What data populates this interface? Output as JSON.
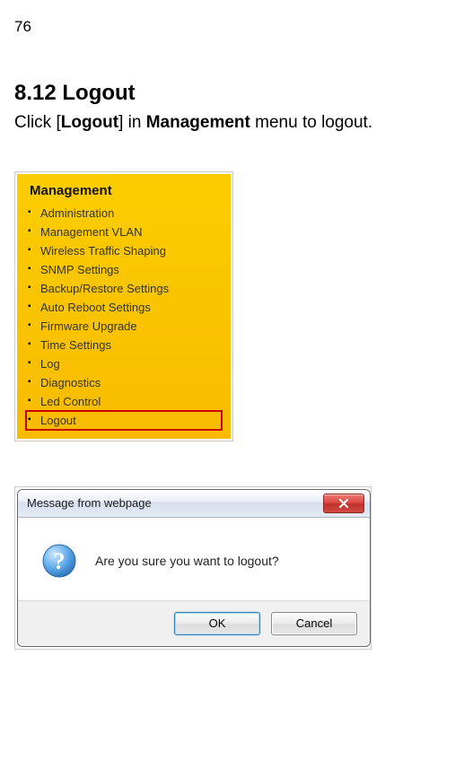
{
  "page": {
    "number": "76"
  },
  "section": {
    "title": "8.12 Logout"
  },
  "instruction": {
    "pre": "Click [",
    "bold1": "Logout",
    "mid": "] in ",
    "bold2": "Management",
    "post": " menu to logout."
  },
  "mgmt": {
    "title": "Management",
    "items": [
      {
        "label": "Administration"
      },
      {
        "label": "Management VLAN"
      },
      {
        "label": "Wireless Traffic Shaping"
      },
      {
        "label": "SNMP Settings"
      },
      {
        "label": "Backup/Restore Settings"
      },
      {
        "label": "Auto Reboot Settings"
      },
      {
        "label": "Firmware Upgrade"
      },
      {
        "label": "Time Settings"
      },
      {
        "label": "Log"
      },
      {
        "label": "Diagnostics"
      },
      {
        "label": "Led Control"
      },
      {
        "label": "Logout"
      }
    ]
  },
  "dialog": {
    "title": "Message from webpage",
    "message": "Are you sure you want to logout?",
    "ok": "OK",
    "cancel": "Cancel"
  }
}
